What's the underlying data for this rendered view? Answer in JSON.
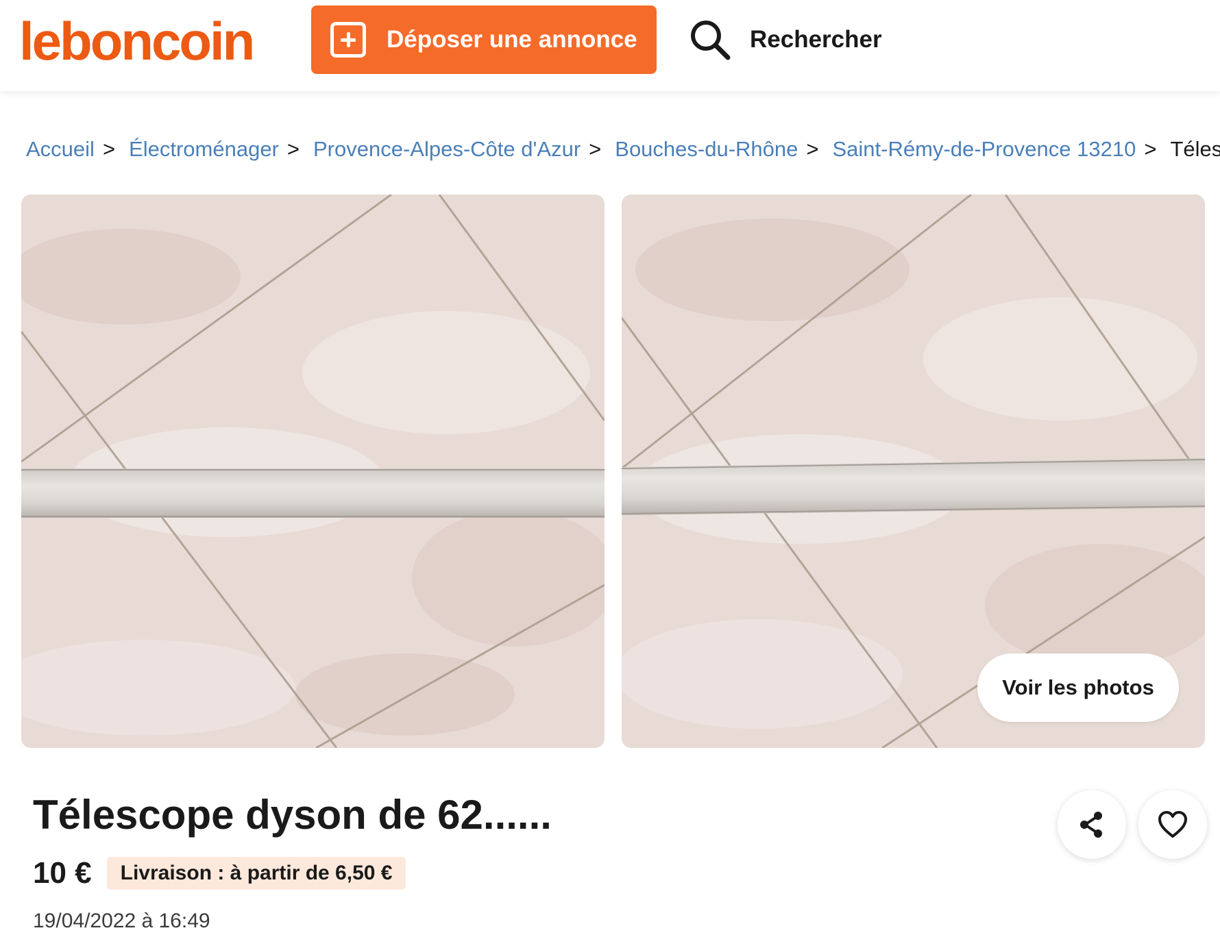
{
  "header": {
    "logo_text": "leboncoin",
    "deposit_label": "Déposer une annonce",
    "search_label": "Rechercher",
    "brand_color": "#ec5a13",
    "deposit_color": "#f56b2a"
  },
  "breadcrumb": {
    "items": [
      {
        "label": "Accueil",
        "sep": ">"
      },
      {
        "label": "Électroménager",
        "sep": ">"
      },
      {
        "label": "Provence-Alpes-Côte d'Azur",
        "sep": ">"
      },
      {
        "label": "Bouches-du-Rhône",
        "sep": ">"
      },
      {
        "label": "Saint-Rémy-de-Provence 13210",
        "sep": ">"
      }
    ],
    "current": "Télesco"
  },
  "gallery": {
    "voir_photos_label": "Voir les photos"
  },
  "listing": {
    "title": "Télescope dyson de 62......",
    "price": "10 €",
    "delivery": "Livraison : à partir de 6,50 €",
    "date": "19/04/2022 à 16:49"
  },
  "icons": {
    "deposit": "plus-square-icon",
    "search": "search-icon",
    "share": "share-icon",
    "favorite": "heart-icon"
  }
}
